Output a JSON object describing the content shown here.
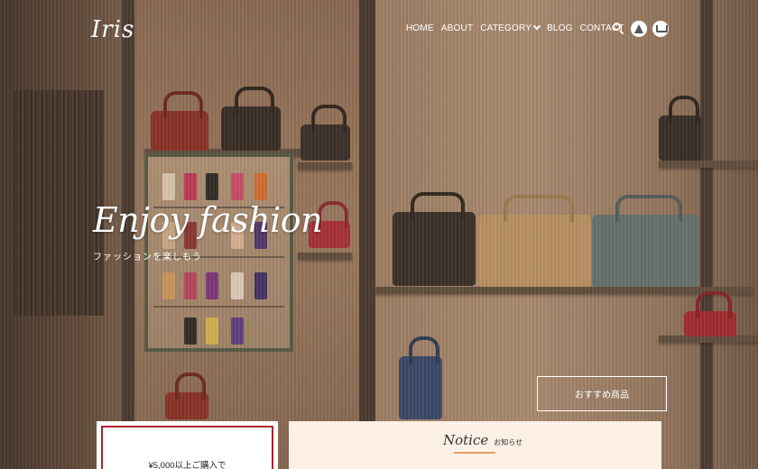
{
  "header": {
    "logo": "Iris",
    "nav": [
      {
        "label": "HOME"
      },
      {
        "label": "ABOUT"
      },
      {
        "label": "CATEGORY"
      },
      {
        "label": "BLOG"
      },
      {
        "label": "CONTACT"
      }
    ],
    "icons": [
      "search-icon",
      "tent-icon",
      "cart-icon"
    ]
  },
  "hero": {
    "title": "Enjoy fashion",
    "subtitle": "ファッションを楽しもう",
    "cta": "おすすめ商品"
  },
  "promo": {
    "text": "¥5,000以上ご購入で"
  },
  "notice": {
    "title_en": "Notice",
    "title_jp": "お知らせ"
  },
  "colors": {
    "promo_border": "#b02030",
    "notice_bg": "#fdf0e6",
    "notice_underline": "#e8a060"
  }
}
